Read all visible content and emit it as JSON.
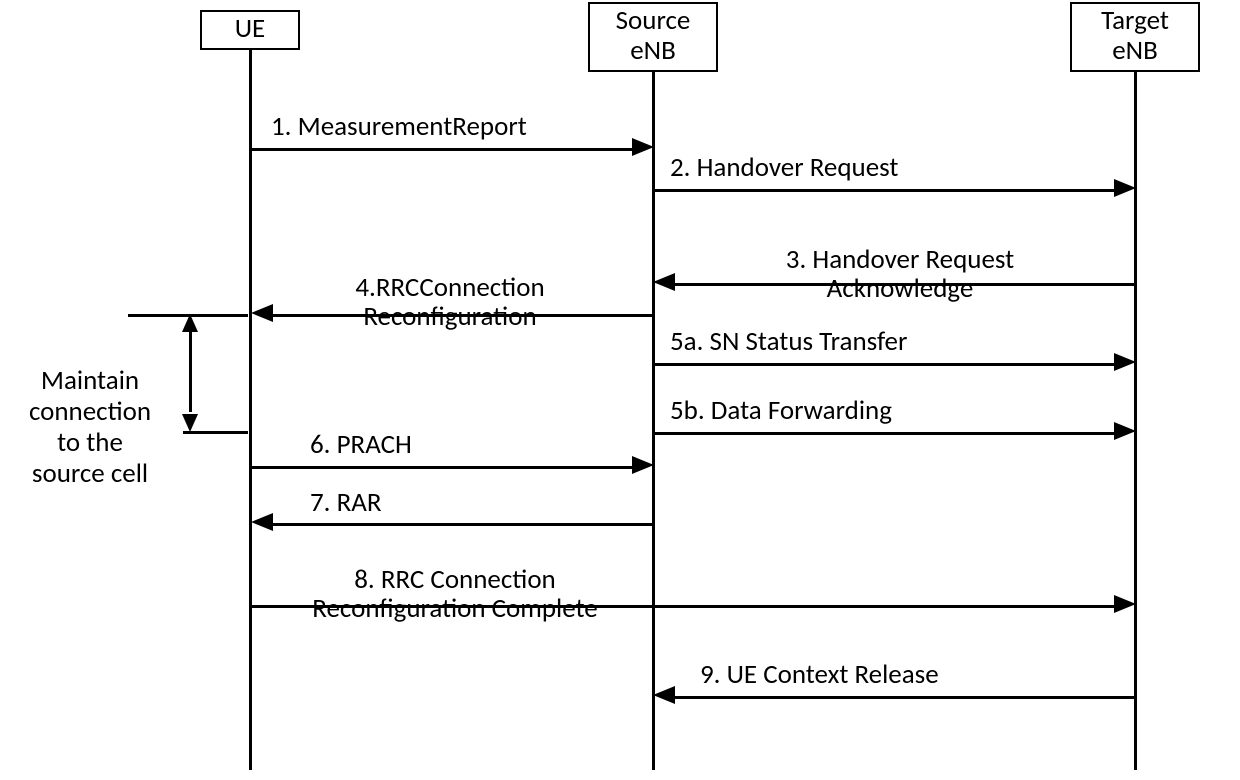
{
  "actors": {
    "ue": "UE",
    "source": "Source\neNB",
    "target": "Target\neNB"
  },
  "messages": {
    "m1": "1. MeasurementReport",
    "m2": "2. Handover Request",
    "m3": "3. Handover Request\nAcknowledge",
    "m4": "4.RRCConnection\nReconfiguration",
    "m5a": "5a. SN Status Transfer",
    "m5b": "5b. Data Forwarding",
    "m6": "6. PRACH",
    "m7": "7. RAR",
    "m8": "8. RRC Connection\nReconfiguration Complete",
    "m9": "9. UE Context Release"
  },
  "note": "Maintain\nconnection\nto the\nsource cell"
}
